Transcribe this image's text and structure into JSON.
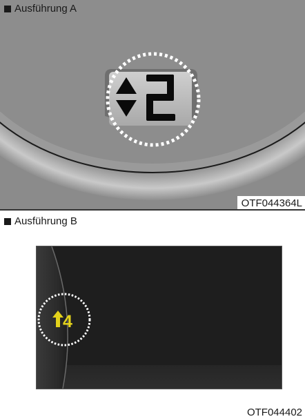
{
  "variant_a": {
    "label": "Ausführung A",
    "code": "OTF044364L",
    "gear_display": "2",
    "colors": {
      "background": "#8b8b8b",
      "display_bg": "#b9b9b9",
      "segment": "#0a0a0a",
      "highlight_ring": "#ffffff"
    },
    "icons": [
      "up-arrow-icon",
      "down-arrow-icon"
    ]
  },
  "variant_b": {
    "label": "Ausführung B",
    "code": "OTF044402",
    "gear_display": "4",
    "colors": {
      "screen_bg": "#1e1e1e",
      "indicator": "#e3d21b",
      "highlight_ring": "#ffffff"
    },
    "icons": [
      "up-arrow-icon"
    ]
  }
}
